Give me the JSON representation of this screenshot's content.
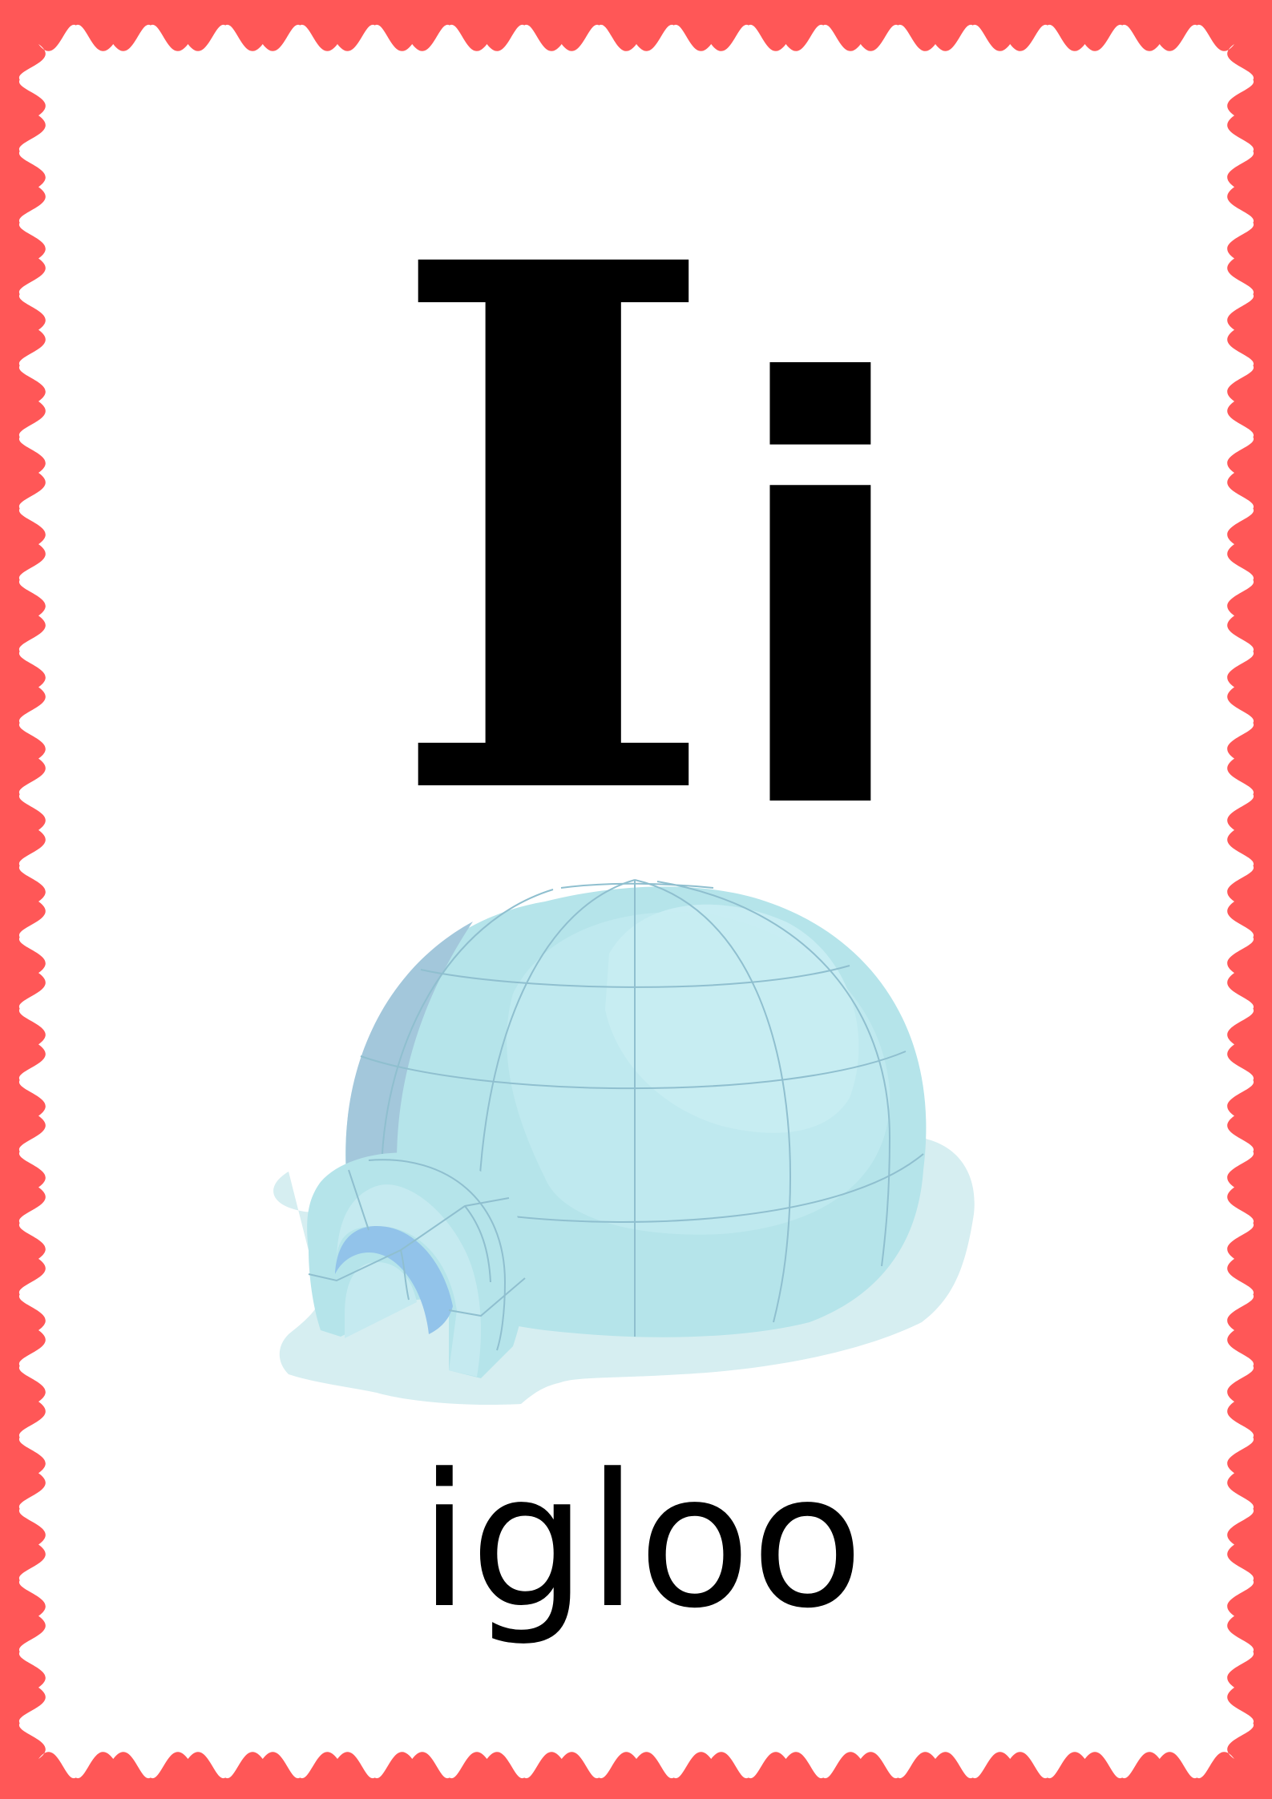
{
  "card": {
    "uppercase_letter": "I",
    "lowercase_letter": "i",
    "word": "igloo",
    "picture_icon": "igloo-icon"
  },
  "colors": {
    "frame": "#ff5757",
    "background": "#ffffff",
    "text": "#000000",
    "igloo_dome": "#b5e4ea",
    "igloo_highlight": "#cbeff4",
    "igloo_shadow": "#a3c7db",
    "igloo_lines": "#8fbfcf",
    "snow": "#d6eef1",
    "door_arch": "#92c3ea"
  }
}
